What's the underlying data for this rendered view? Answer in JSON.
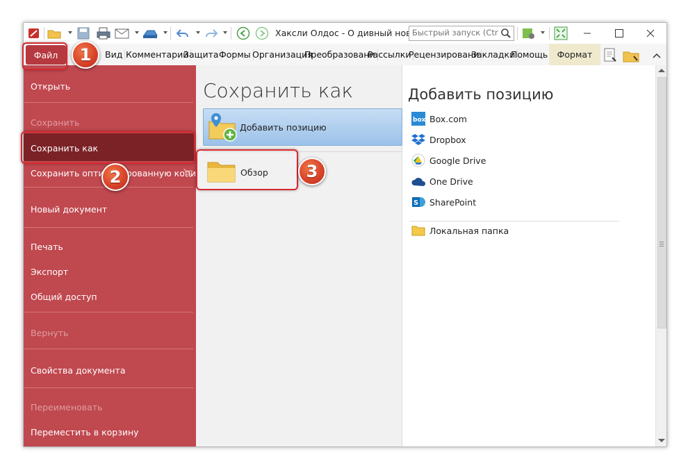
{
  "window": {
    "title": "Хаксли Олдос - О дивный новый ...",
    "quick_launch_placeholder": "Быстрый запуск (Ctrl..."
  },
  "icons": [
    "app-logo-icon",
    "open-folder-icon",
    "save-icon",
    "print-icon",
    "email-icon",
    "scan-icon",
    "undo-icon",
    "redo-icon",
    "back-icon",
    "forward-icon",
    "search-icon",
    "minimize-icon",
    "maximize-icon",
    "close-icon"
  ],
  "menu": {
    "file": "Файл",
    "items": [
      "Вид",
      "Комментарий",
      "Защита",
      "Формы",
      "Организация",
      "Преобразовани",
      "Рассылки",
      "Рецензировани",
      "Закладки",
      "Помощь"
    ],
    "format": "Формат"
  },
  "left": {
    "open": "Открыть",
    "save": "Сохранить",
    "save_as": "Сохранить как",
    "save_optimized": "Сохранить оптимизированную копию",
    "new_doc": "Новый документ",
    "print": "Печать",
    "export": "Экспорт",
    "share": "Общий доступ",
    "revert": "Вернуть",
    "properties": "Свойства документа",
    "rename": "Переименовать",
    "trash": "Переместить в корзину"
  },
  "middle": {
    "title": "Сохранить как",
    "add_location": "Добавить позицию",
    "browse": "Обзор"
  },
  "right": {
    "title": "Добавить позицию",
    "locations": [
      "Box.com",
      "Dropbox",
      "Google Drive",
      "One Drive",
      "SharePoint"
    ],
    "local_folder": "Локальная папка"
  },
  "badges": {
    "one": "1",
    "two": "2",
    "three": "3"
  },
  "colors": {
    "accent": "#c0484f",
    "selected": "#7b2226",
    "annotation": "#d7282f"
  }
}
